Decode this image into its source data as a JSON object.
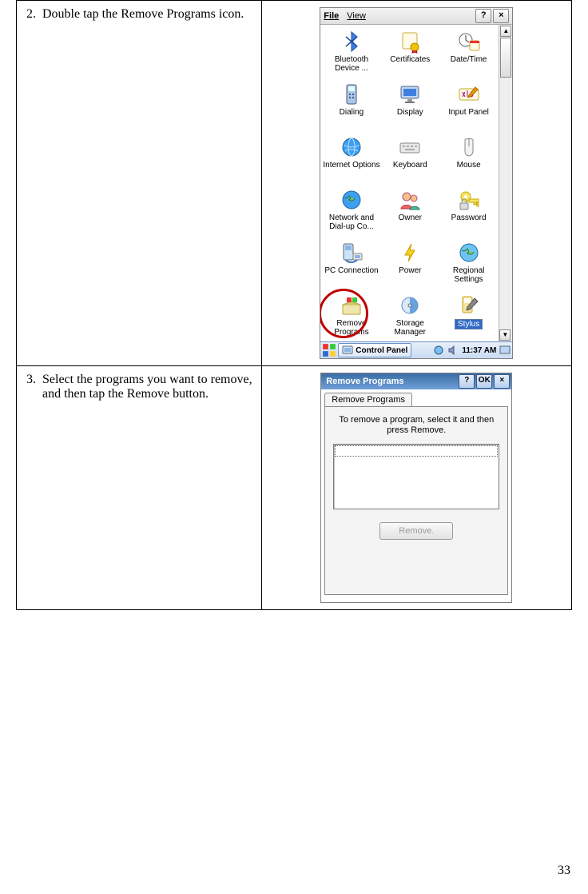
{
  "page_number": "33",
  "steps": {
    "s2": {
      "num": "2",
      "text": "Double tap the Remove Programs icon."
    },
    "s3": {
      "num": "3",
      "text": "Select the programs you want to remove, and then tap the Remove button."
    }
  },
  "shot1": {
    "menu": {
      "file": "File",
      "view": "View",
      "help": "?",
      "close": "×"
    },
    "icons": [
      {
        "label": "Bluetooth Device ...",
        "name": "bluetooth-icon"
      },
      {
        "label": "Certificates",
        "name": "certificates-icon"
      },
      {
        "label": "Date/Time",
        "name": "datetime-icon"
      },
      {
        "label": "Dialing",
        "name": "dialing-icon"
      },
      {
        "label": "Display",
        "name": "display-icon"
      },
      {
        "label": "Input Panel",
        "name": "inputpanel-icon"
      },
      {
        "label": "Internet Options",
        "name": "internet-options-icon"
      },
      {
        "label": "Keyboard",
        "name": "keyboard-icon"
      },
      {
        "label": "Mouse",
        "name": "mouse-icon"
      },
      {
        "label": "Network and Dial-up Co...",
        "name": "network-icon"
      },
      {
        "label": "Owner",
        "name": "owner-icon"
      },
      {
        "label": "Password",
        "name": "password-icon"
      },
      {
        "label": "PC Connection",
        "name": "pc-connection-icon"
      },
      {
        "label": "Power",
        "name": "power-icon"
      },
      {
        "label": "Regional Settings",
        "name": "regional-icon"
      },
      {
        "label": "Remove Programs",
        "name": "remove-programs-icon",
        "circled": true
      },
      {
        "label": "Storage Manager",
        "name": "storage-icon"
      },
      {
        "label": "Stylus",
        "name": "stylus-icon",
        "selected": true
      }
    ],
    "taskbar": {
      "button": "Control Panel",
      "clock": "11:37 AM"
    }
  },
  "shot2": {
    "title": "Remove Programs",
    "help": "?",
    "ok": "OK",
    "close": "×",
    "tab": "Remove Programs",
    "instr": "To remove a program, select it and then press Remove.",
    "remove_btn": "Remove."
  }
}
